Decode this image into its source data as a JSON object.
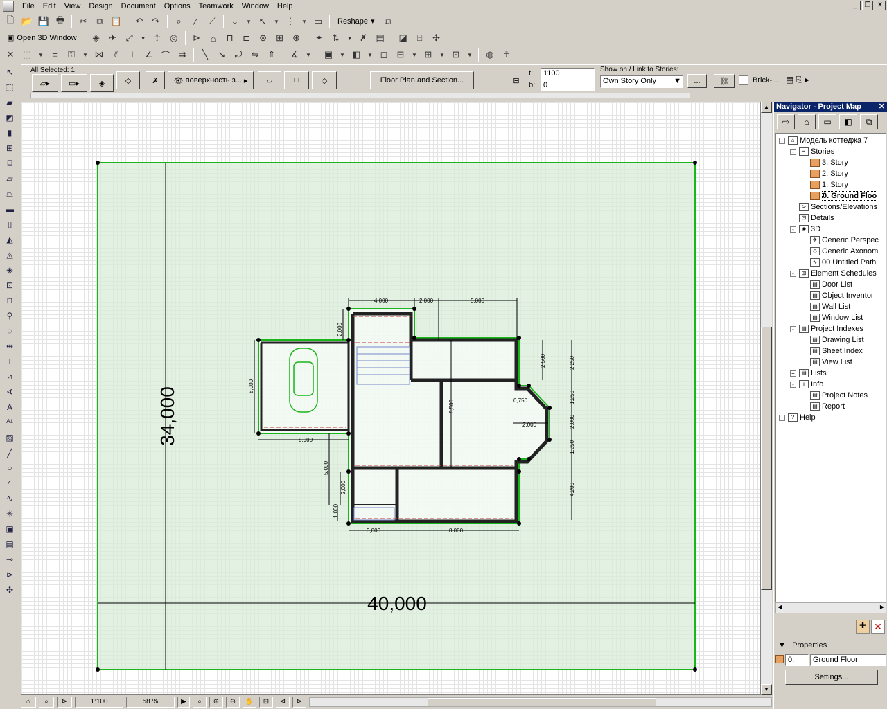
{
  "menu": [
    "File",
    "Edit",
    "View",
    "Design",
    "Document",
    "Options",
    "Teamwork",
    "Window",
    "Help"
  ],
  "toolbar2": {
    "open_3d": "Open 3D Window"
  },
  "toolbar1": {
    "reshape": "Reshape"
  },
  "infobox": {
    "all_selected": "All Selected: 1",
    "surface": "поверхность з...",
    "floor_plan_btn": "Floor Plan and Section...",
    "t_label": "t:",
    "t_value": "1100",
    "b_label": "b:",
    "b_value": "0",
    "show_on_label": "Show on / Link to Stories:",
    "show_on_value": "Own Story Only",
    "ellipsis": "...",
    "material": "Brick-..."
  },
  "plan": {
    "dim_height": "34,000",
    "dim_width": "40,000",
    "dims": [
      "4,000",
      "2,000",
      "5,000",
      "2,000",
      "8,000",
      "8,000",
      "8,500",
      "2,500",
      "2,250",
      "0,750",
      "1,250",
      "2,000",
      "2,000",
      "1,250",
      "5,000",
      "2,000",
      "1,000",
      "4,200",
      "3,000",
      "8,000"
    ]
  },
  "status": {
    "scale": "1:100",
    "zoom": "58 %"
  },
  "navigator": {
    "title": "Navigator - Project Map",
    "close": "✕",
    "tree": [
      {
        "label": "Модель коттеджа 7",
        "level": 0,
        "exp": "-",
        "icon": "house"
      },
      {
        "label": "Stories",
        "level": 1,
        "exp": "-",
        "icon": "stories"
      },
      {
        "label": "3. Story",
        "level": 2,
        "exp": "",
        "icon": "story"
      },
      {
        "label": "2. Story",
        "level": 2,
        "exp": "",
        "icon": "story"
      },
      {
        "label": "1. Story",
        "level": 2,
        "exp": "",
        "icon": "story"
      },
      {
        "label": "0. Ground Floo",
        "level": 2,
        "exp": "",
        "icon": "story",
        "selected": true
      },
      {
        "label": "Sections/Elevations",
        "level": 1,
        "exp": "",
        "icon": "section"
      },
      {
        "label": "Details",
        "level": 1,
        "exp": "",
        "icon": "detail"
      },
      {
        "label": "3D",
        "level": 1,
        "exp": "-",
        "icon": "3d"
      },
      {
        "label": "Generic Perspec",
        "level": 2,
        "exp": "",
        "icon": "camera"
      },
      {
        "label": "Generic Axonom",
        "level": 2,
        "exp": "",
        "icon": "box"
      },
      {
        "label": "00 Untitled Path",
        "level": 2,
        "exp": "",
        "icon": "path"
      },
      {
        "label": "Element Schedules",
        "level": 1,
        "exp": "-",
        "icon": "table"
      },
      {
        "label": "Door List",
        "level": 2,
        "exp": "",
        "icon": "list"
      },
      {
        "label": "Object Inventor",
        "level": 2,
        "exp": "",
        "icon": "list"
      },
      {
        "label": "Wall List",
        "level": 2,
        "exp": "",
        "icon": "list"
      },
      {
        "label": "Window List",
        "level": 2,
        "exp": "",
        "icon": "list"
      },
      {
        "label": "Project Indexes",
        "level": 1,
        "exp": "-",
        "icon": "index"
      },
      {
        "label": "Drawing List",
        "level": 2,
        "exp": "",
        "icon": "list"
      },
      {
        "label": "Sheet Index",
        "level": 2,
        "exp": "",
        "icon": "list"
      },
      {
        "label": "View List",
        "level": 2,
        "exp": "",
        "icon": "list"
      },
      {
        "label": "Lists",
        "level": 1,
        "exp": "+",
        "icon": "lists"
      },
      {
        "label": "Info",
        "level": 1,
        "exp": "-",
        "icon": "info"
      },
      {
        "label": "Project Notes",
        "level": 2,
        "exp": "",
        "icon": "doc"
      },
      {
        "label": "Report",
        "level": 2,
        "exp": "",
        "icon": "doc"
      },
      {
        "label": "Help",
        "level": 0,
        "exp": "+",
        "icon": "help"
      }
    ],
    "properties_label": "Properties",
    "prop_id": "0.",
    "prop_name": "Ground Floor",
    "settings_btn": "Settings..."
  },
  "colors": {
    "green_fill": "#d8ecd8",
    "green_stroke": "#1ab51a",
    "wall_red": "#cc3333",
    "nav_title_bg": "#0a246a"
  }
}
